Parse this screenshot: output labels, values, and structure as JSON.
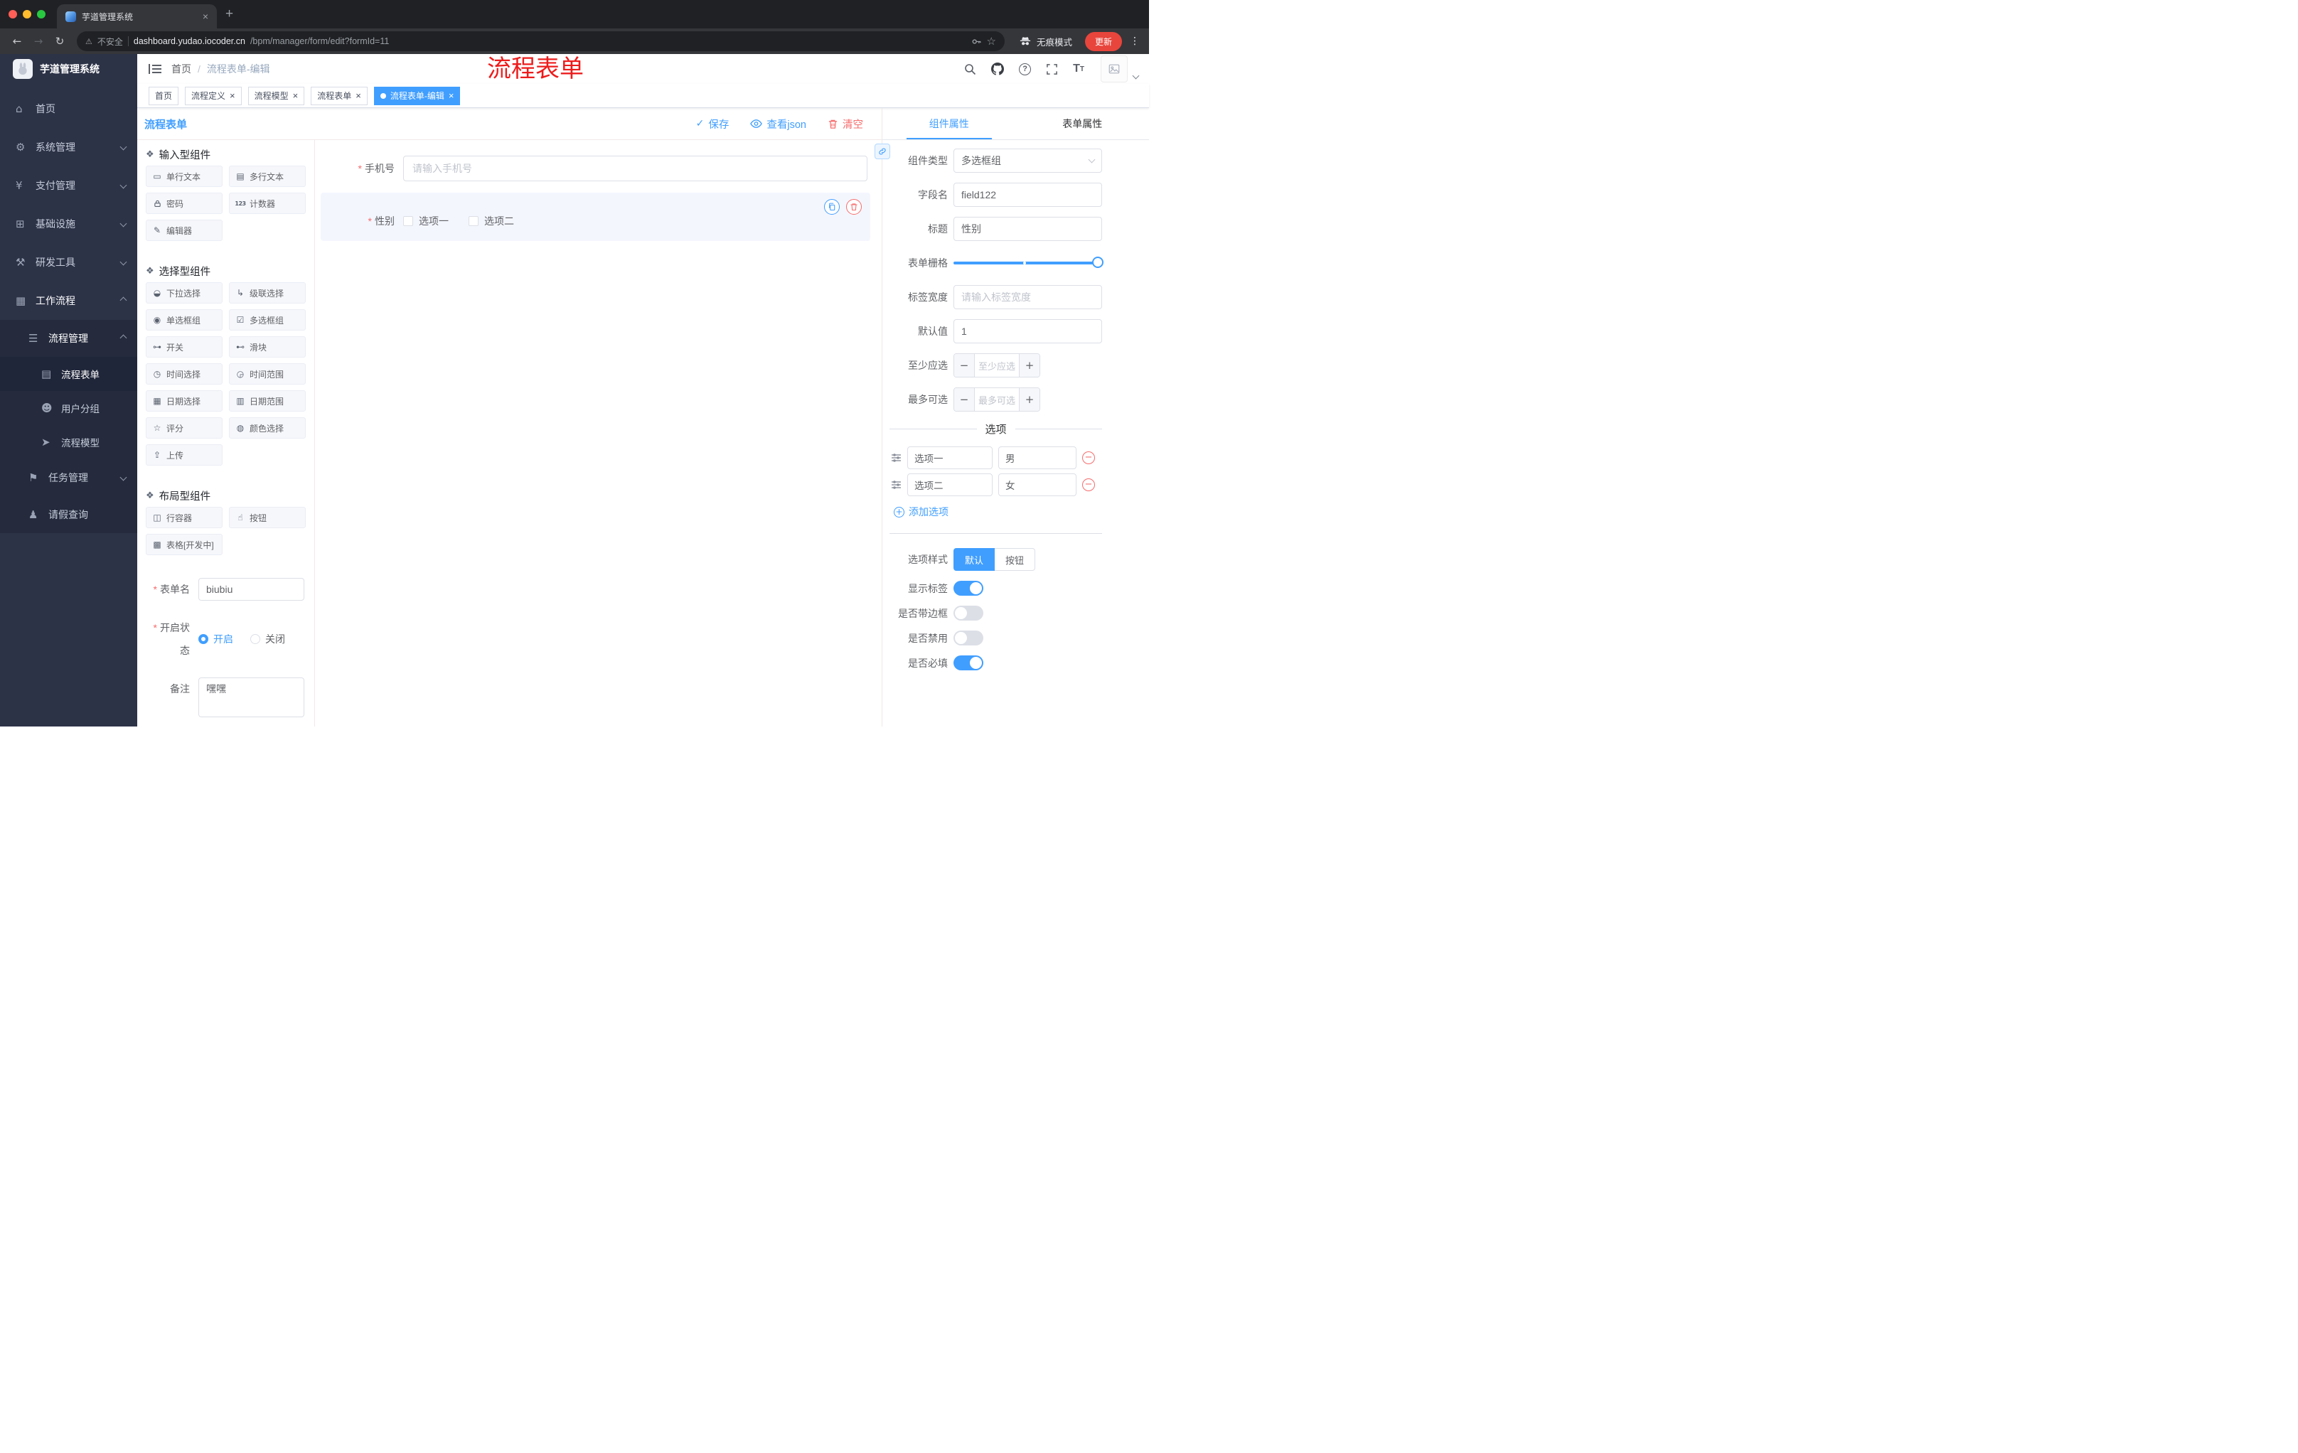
{
  "colors": {
    "accent": "#409eff",
    "danger": "#f56c6c",
    "annotation_red": "#ed1c1c",
    "sidebar_bg": "#2d3347",
    "active_tag": "#409eff"
  },
  "browser": {
    "tab_title": "芋道管理系统",
    "security_label": "不安全",
    "url_host": "dashboard.yudao.iocoder.cn",
    "url_path": "/bpm/manager/form/edit?formId=11",
    "incognito_label": "无痕模式",
    "update_label": "更新"
  },
  "sidebar": {
    "logo_title": "芋道管理系统",
    "menu": [
      {
        "label": "首页"
      },
      {
        "label": "系统管理"
      },
      {
        "label": "支付管理"
      },
      {
        "label": "基础设施"
      },
      {
        "label": "研发工具"
      },
      {
        "label": "工作流程"
      }
    ],
    "workflow_submenu": {
      "process_management": {
        "label": "流程管理",
        "children": [
          {
            "label": "流程表单"
          },
          {
            "label": "用户分组"
          },
          {
            "label": "流程模型"
          }
        ]
      },
      "task_management": {
        "label": "任务管理"
      },
      "leave_query": {
        "label": "请假查询"
      }
    }
  },
  "header": {
    "breadcrumb": {
      "home": "首页",
      "current": "流程表单-编辑"
    },
    "annotation": "流程表单"
  },
  "tags": [
    {
      "label": "首页"
    },
    {
      "label": "流程定义"
    },
    {
      "label": "流程模型"
    },
    {
      "label": "流程表单"
    },
    {
      "label": "流程表单-编辑"
    }
  ],
  "designer": {
    "title": "流程表单",
    "actions": {
      "save": "保存",
      "view_json": "查看json",
      "clear": "清空"
    },
    "palette": {
      "sections": [
        {
          "title": "输入型组件",
          "items": [
            {
              "label": "单行文本"
            },
            {
              "label": "多行文本"
            },
            {
              "label": "密码"
            },
            {
              "label": "计数器"
            },
            {
              "label": "编辑器"
            }
          ]
        },
        {
          "title": "选择型组件",
          "items": [
            {
              "label": "下拉选择"
            },
            {
              "label": "级联选择"
            },
            {
              "label": "单选框组"
            },
            {
              "label": "多选框组"
            },
            {
              "label": "开关"
            },
            {
              "label": "滑块"
            },
            {
              "label": "时间选择"
            },
            {
              "label": "时间范围"
            },
            {
              "label": "日期选择"
            },
            {
              "label": "日期范围"
            },
            {
              "label": "评分"
            },
            {
              "label": "颜色选择"
            },
            {
              "label": "上传"
            }
          ]
        },
        {
          "title": "布局型组件",
          "items": [
            {
              "label": "行容器"
            },
            {
              "label": "按钮"
            },
            {
              "label": "表格[开发中]"
            }
          ]
        }
      ]
    },
    "form_config": {
      "name_label": "表单名",
      "name_value": "biubiu",
      "status_label": "开启状态",
      "status_on": "开启",
      "status_off": "关闭",
      "remark_label": "备注",
      "remark_value": "嘿嘿"
    },
    "canvas": {
      "phone_field": {
        "label": "手机号",
        "placeholder": "请输入手机号"
      },
      "gender_field": {
        "label": "性别",
        "options": [
          {
            "label": "选项一"
          },
          {
            "label": "选项二"
          }
        ]
      }
    }
  },
  "properties": {
    "tabs": {
      "component": "组件属性",
      "form": "表单属性"
    },
    "component_type": {
      "label": "组件类型",
      "value": "多选框组"
    },
    "field_name": {
      "label": "字段名",
      "value": "field122"
    },
    "title": {
      "label": "标题",
      "value": "性别"
    },
    "grid": {
      "label": "表单栅格"
    },
    "label_width": {
      "label": "标签宽度",
      "placeholder": "请输入标签宽度"
    },
    "default_value": {
      "label": "默认值",
      "value": "1"
    },
    "min_select": {
      "label": "至少应选",
      "placeholder": "至少应选"
    },
    "max_select": {
      "label": "最多可选",
      "placeholder": "最多可选"
    },
    "options_section": {
      "title": "选项",
      "rows": [
        {
          "label": "选项一",
          "value": "男"
        },
        {
          "label": "选项二",
          "value": "女"
        }
      ],
      "add_label": "添加选项"
    },
    "option_style": {
      "label": "选项样式",
      "default": "默认",
      "button": "按钮"
    },
    "switches": [
      {
        "label": "显示标签",
        "on": true
      },
      {
        "label": "是否带边框",
        "on": false
      },
      {
        "label": "是否禁用",
        "on": false
      },
      {
        "label": "是否必填",
        "on": true
      }
    ]
  }
}
